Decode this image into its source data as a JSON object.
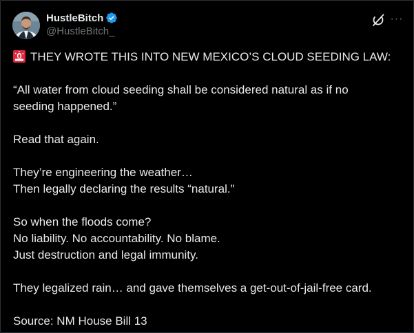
{
  "author": {
    "display_name": "HustleBitch",
    "handle": "@HustleBitch_",
    "verified": true,
    "verified_color": "#1d9bf0"
  },
  "header_icons": {
    "grok": "grok-slash-icon",
    "more": "···"
  },
  "tweet": {
    "headline_emoji": "rotating-light-icon",
    "headline": "THEY WROTE THIS INTO NEW MEXICO’S CLOUD SEEDING LAW:",
    "quote_line_1": "“All water from cloud seeding shall be considered natural as if no",
    "quote_line_2": "seeding happened.”",
    "read_again": "Read that again.",
    "engineering_line_1": "They’re engineering the weather…",
    "engineering_line_2": "Then legally declaring the results “natural.”",
    "floods_line_1": "So when the floods come?",
    "floods_line_2": "No liability. No accountability. No blame.",
    "floods_line_3": "Just destruction and legal immunity.",
    "legalized": "They legalized rain… and gave themselves a get-out-of-jail-free card.",
    "source": "Source: NM House Bill 13"
  },
  "colors": {
    "background": "#000000",
    "text_primary": "#e7e9ea",
    "text_secondary": "#71767b",
    "border": "#2f3336",
    "siren": "#e0283c"
  }
}
